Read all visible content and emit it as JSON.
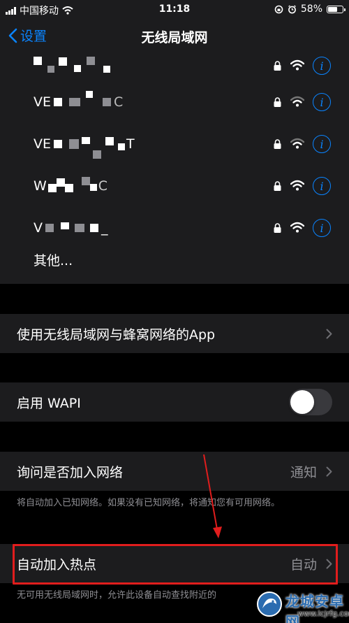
{
  "status_bar": {
    "carrier": "中国移动",
    "time": "11:18",
    "battery_percent": "58%"
  },
  "nav": {
    "back_label": "设置",
    "title": "无线局域网"
  },
  "networks": [
    {
      "ssid_visible": "",
      "secured": true
    },
    {
      "ssid_visible": "VE",
      "ssid_tail": "C",
      "secured": true
    },
    {
      "ssid_visible": "VE",
      "ssid_tail": "T",
      "secured": true
    },
    {
      "ssid_visible": "W",
      "ssid_tail": "C",
      "secured": true
    },
    {
      "ssid_visible": "V",
      "ssid_tail": "_",
      "secured": true
    }
  ],
  "other_label": "其他...",
  "settings": {
    "apps_label": "使用无线局域网与蜂窝网络的App",
    "wapi_label": "启用 WAPI",
    "wapi_enabled": false,
    "ask_join_label": "询问是否加入网络",
    "ask_join_value": "通知",
    "ask_join_footnote": "将自动加入已知网络。如果没有已知网络，将通知您有可用网络。",
    "hotspot_label": "自动加入热点",
    "hotspot_value": "自动",
    "hotspot_footnote": "无可用无线局域网时，允许此设备自动查找附近的"
  },
  "watermark": {
    "name": "龙城安卓网",
    "url": "www.lcjrfg.com"
  },
  "colors": {
    "accent": "#0a84ff",
    "highlight": "#e11d1d",
    "cell_bg": "#1c1c1e"
  }
}
